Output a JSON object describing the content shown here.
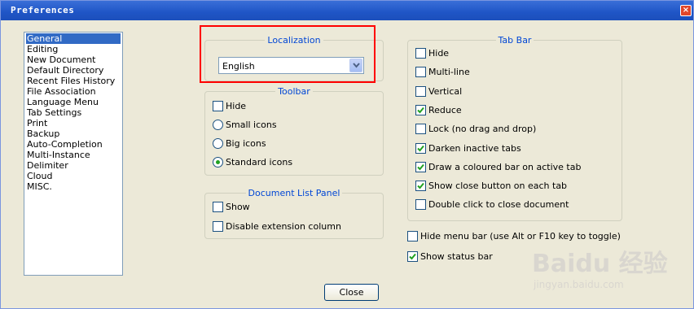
{
  "window": {
    "title": "Preferences",
    "close_glyph": "×"
  },
  "categories": {
    "selected_index": 0,
    "items": [
      "General",
      "Editing",
      "New Document",
      "Default Directory",
      "Recent Files History",
      "File Association",
      "Language Menu",
      "Tab Settings",
      "Print",
      "Backup",
      "Auto-Completion",
      "Multi-Instance",
      "Delimiter",
      "Cloud",
      "MISC."
    ]
  },
  "localization": {
    "legend": "Localization",
    "selected_language": "English"
  },
  "toolbar": {
    "legend": "Toolbar",
    "hide_label": "Hide",
    "hide_checked": false,
    "options": [
      {
        "label": "Small icons",
        "selected": false
      },
      {
        "label": "Big icons",
        "selected": false
      },
      {
        "label": "Standard icons",
        "selected": true
      }
    ]
  },
  "doclist": {
    "legend": "Document List Panel",
    "show_label": "Show",
    "show_checked": false,
    "disable_ext_label": "Disable extension column",
    "disable_ext_checked": false
  },
  "tabbar": {
    "legend": "Tab Bar",
    "options": [
      {
        "label": "Hide",
        "checked": false
      },
      {
        "label": "Multi-line",
        "checked": false
      },
      {
        "label": "Vertical",
        "checked": false
      },
      {
        "label": "Reduce",
        "checked": true
      },
      {
        "label": "Lock (no drag and drop)",
        "checked": false
      },
      {
        "label": "Darken inactive tabs",
        "checked": true
      },
      {
        "label": "Draw a coloured bar on active tab",
        "checked": true
      },
      {
        "label": "Show close button on each tab",
        "checked": true
      },
      {
        "label": "Double click to close document",
        "checked": false
      }
    ]
  },
  "misc": {
    "hide_menu_label": "Hide menu bar (use Alt or F10 key to toggle)",
    "hide_menu_checked": false,
    "status_bar_label": "Show status bar",
    "status_bar_checked": true
  },
  "buttons": {
    "close_label": "Close"
  },
  "watermark": {
    "brand": "Baidu 经验",
    "url": "jingyan.baidu.com"
  }
}
